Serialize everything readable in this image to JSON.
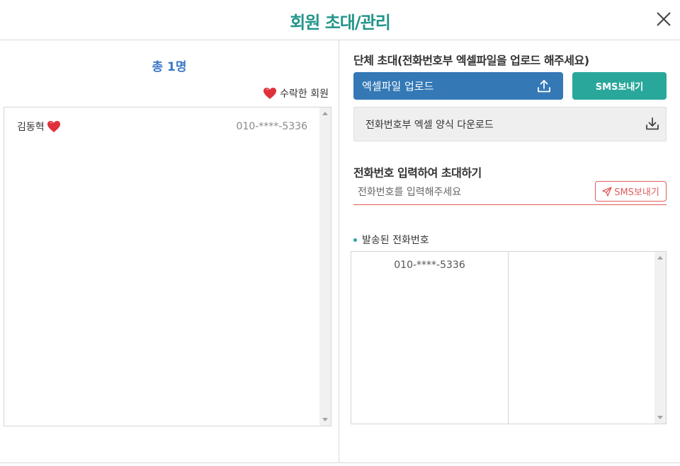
{
  "header": {
    "title": "회원 초대/관리",
    "close_icon": "close-icon"
  },
  "left": {
    "total_label": "총 1명",
    "legend_label": "수락한 회원",
    "legend_icon": "heart-icon",
    "members": [
      {
        "name": "김동혁",
        "accepted": true,
        "phone": "010-****-5336"
      }
    ]
  },
  "right": {
    "group_title": "단체 초대(전화번호부 엑셀파일을 업로드 해주세요)",
    "upload_label": "엑셀파일 업로드",
    "upload_icon": "upload-icon",
    "sms_send_label": "SMS보내기",
    "download_label": "전화번호부 엑셀 양식 다운로드",
    "download_icon": "download-icon",
    "input_title": "전화번호 입력하여 초대하기",
    "phone_placeholder": "전화번호를 입력해주세요",
    "phone_value": "",
    "sms_send_outline_label": "SMS보내기",
    "send_icon": "paper-plane-icon",
    "sent_title": "발송된 전화번호",
    "sent_numbers": [
      "010-****-5336"
    ]
  },
  "colors": {
    "title": "#23958a",
    "total": "#3a78c8",
    "upload_button": "#3478b6",
    "sms_button": "#2aa79b",
    "accent_red": "#e05c5c",
    "heart": "#e0303c"
  }
}
